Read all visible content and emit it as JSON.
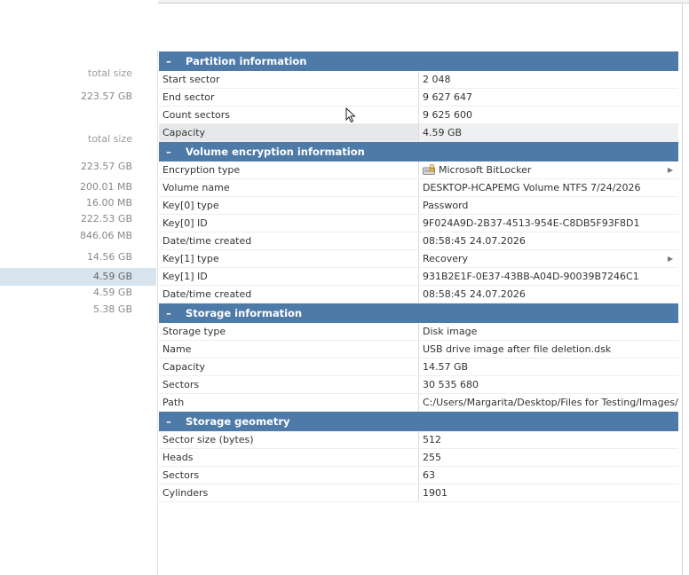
{
  "left_panel": {
    "items": [
      {
        "text": "total size",
        "kind": "header"
      },
      {
        "text": "223.57 GB",
        "kind": "value"
      },
      {
        "text": "total size",
        "kind": "header"
      },
      {
        "text": "223.57 GB",
        "kind": "value"
      },
      {
        "text": "200.01 MB",
        "kind": "value"
      },
      {
        "text": "16.00 MB",
        "kind": "value"
      },
      {
        "text": "222.53 GB",
        "kind": "value"
      },
      {
        "text": "846.06 MB",
        "kind": "value"
      },
      {
        "text": "14.56 GB",
        "kind": "value"
      },
      {
        "text": "4.59 GB",
        "kind": "selected"
      },
      {
        "text": "4.59 GB",
        "kind": "value"
      },
      {
        "text": "5.38 GB",
        "kind": "value"
      }
    ]
  },
  "sections": [
    {
      "title": "Partition information",
      "toggle": "–",
      "rows": [
        {
          "key": "Start sector",
          "value": "2 048"
        },
        {
          "key": "End sector",
          "value": "9 627 647"
        },
        {
          "key": "Count sectors",
          "value": "9 625 600"
        },
        {
          "key": "Capacity",
          "value": "4.59 GB"
        }
      ]
    },
    {
      "title": "Volume encryption information",
      "toggle": "–",
      "rows": [
        {
          "key": "Encryption type",
          "value": "Microsoft BitLocker"
        },
        {
          "key": "Volume name",
          "value": "DESKTOP-HCAPEMG Volume NTFS  7/24/2026"
        },
        {
          "key": "Key[0] type",
          "value": "Password"
        },
        {
          "key": "Key[0] ID",
          "value": "9F024A9D-2B37-4513-954E-C8DB5F93F8D1"
        },
        {
          "key": "Date/time created",
          "value": "08:58:45 24.07.2026"
        },
        {
          "key": "Key[1] type",
          "value": "Recovery"
        },
        {
          "key": "Key[1] ID",
          "value": "931B2E1F-0E37-43BB-A04D-90039B7246C1"
        },
        {
          "key": "Date/time created",
          "value": "08:58:45 24.07.2026"
        }
      ]
    },
    {
      "title": "Storage information",
      "toggle": "–",
      "rows": [
        {
          "key": "Storage type",
          "value": "Disk image"
        },
        {
          "key": "Name",
          "value": "USB drive image after file deletion.dsk"
        },
        {
          "key": "Capacity",
          "value": "14.57 GB"
        },
        {
          "key": "Sectors",
          "value": "30 535 680"
        },
        {
          "key": "Path",
          "value": "C:/Users/Margarita/Desktop/Files for Testing/Images/USB drive image after file deletion.dsk"
        }
      ]
    },
    {
      "title": "Storage geometry",
      "toggle": "–",
      "rows": [
        {
          "key": "Sector size (bytes)",
          "value": "512"
        },
        {
          "key": "Heads",
          "value": "255"
        },
        {
          "key": "Sectors",
          "value": "63"
        },
        {
          "key": "Cylinders",
          "value": "1901"
        }
      ]
    }
  ],
  "colors": {
    "section_header": "#4e7aa8",
    "selected_left": "#d8e4ee"
  }
}
